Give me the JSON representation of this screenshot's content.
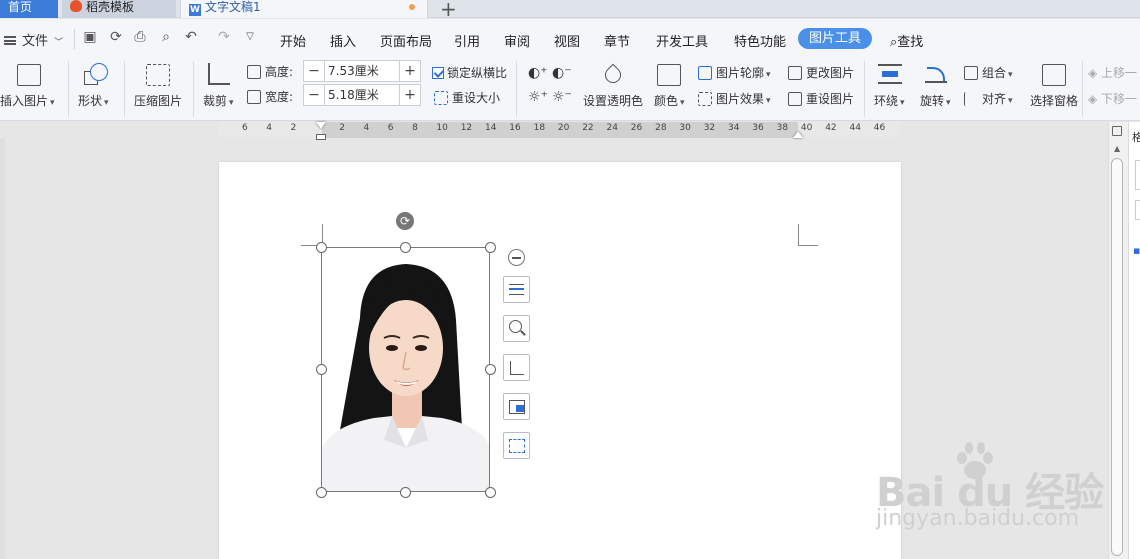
{
  "tabs": {
    "home": "首页",
    "template": "稻壳模板",
    "document": "文字文稿1"
  },
  "menu": {
    "file": "文件",
    "items": [
      "开始",
      "插入",
      "页面布局",
      "引用",
      "审阅",
      "视图",
      "章节",
      "开发工具",
      "特色功能"
    ],
    "active": "图片工具",
    "search": "查找"
  },
  "ribbon": {
    "insert_picture": "插入图片",
    "shape": "形状",
    "compress_picture": "压缩图片",
    "crop": "裁剪",
    "height_label": "高度:",
    "height_value": "7.53厘米",
    "width_label": "宽度:",
    "width_value": "5.18厘米",
    "lock_ratio": "锁定纵横比",
    "reset_size": "重设大小",
    "set_transparent": "设置透明色",
    "color": "颜色",
    "picture_outline": "图片轮廓",
    "picture_effect": "图片效果",
    "change_picture": "更改图片",
    "reset_picture": "重设图片",
    "wrap": "环绕",
    "rotate": "旋转",
    "group": "组合",
    "align": "对齐",
    "selection_pane": "选择窗格",
    "bring_forward": "上移一",
    "send_backward": "下移一"
  },
  "ruler": {
    "ticks": [
      "6",
      "4",
      "2",
      "2",
      "4",
      "6",
      "8",
      "10",
      "12",
      "14",
      "16",
      "18",
      "20",
      "22",
      "24",
      "26",
      "28",
      "30",
      "32",
      "34",
      "36",
      "38",
      "40",
      "42",
      "44",
      "46"
    ]
  },
  "side_panel": {
    "label": "格"
  },
  "watermark": {
    "main": "Bai du 经验",
    "sub": "jingyan.baidu.com"
  },
  "colors": {
    "accent": "#4a8fe8",
    "home_tab": "#3d7bd9"
  }
}
